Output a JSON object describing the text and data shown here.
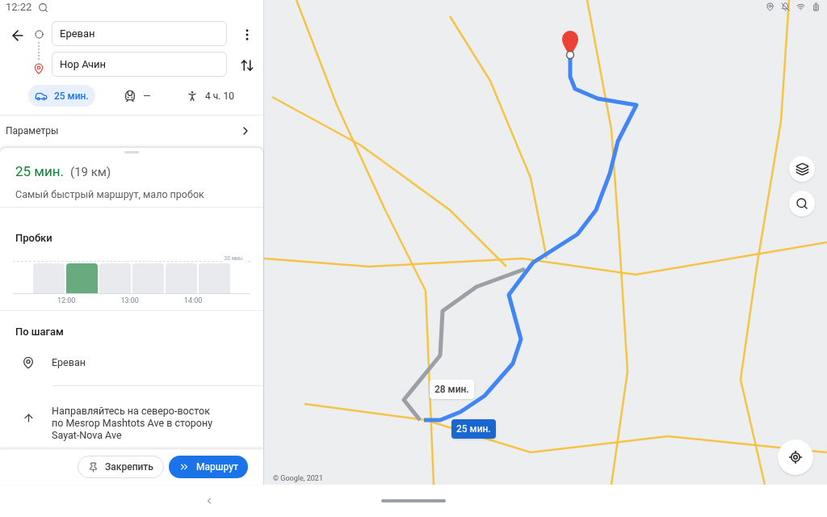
{
  "status_bar": {
    "time": "12:22"
  },
  "directions": {
    "from": "Ереван",
    "to": "Нор Ачин"
  },
  "modes": [
    {
      "kind": "car",
      "label": "25 мин.",
      "selected": true
    },
    {
      "kind": "transit",
      "label": "—",
      "selected": false
    },
    {
      "kind": "walk",
      "label": "4 ч. 10",
      "selected": false
    }
  ],
  "options": {
    "label": "Параметры"
  },
  "route": {
    "duration": "25 мин.",
    "distance": "(19 км)",
    "description": "Самый быстрый маршрут, мало пробок"
  },
  "traffic": {
    "title": "Пробки",
    "max_label": "30 мин.",
    "bars": [
      {
        "selected": false
      },
      {
        "selected": true
      },
      {
        "selected": false
      },
      {
        "selected": false
      },
      {
        "selected": false
      },
      {
        "selected": false
      }
    ],
    "hour_labels": [
      "12:00",
      "13:00",
      "14:00"
    ]
  },
  "steps": {
    "title": "По шагам",
    "items": [
      {
        "kind": "place",
        "text": "Ереван"
      },
      {
        "kind": "straight",
        "text": "Направляйтесь на северо-восток по Mesrop Mashtots Ave в сторону Sayat-Nova Ave"
      }
    ]
  },
  "actions": [
    {
      "kind": "pin",
      "label": "Закрепить"
    },
    {
      "kind": "start",
      "label": "Маршрут"
    }
  ],
  "map": {
    "route_chips": [
      {
        "label": "28 мин.",
        "selected": false
      },
      {
        "label": "25 мин.",
        "selected": true
      }
    ],
    "copyright": "© Google, 2021"
  }
}
